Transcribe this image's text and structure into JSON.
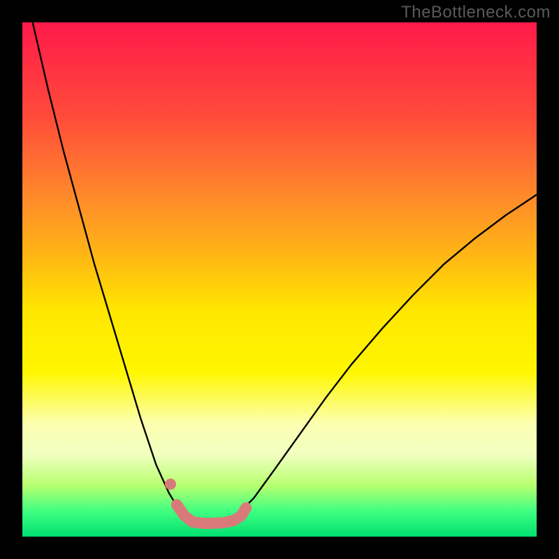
{
  "watermark": "TheBottleneck.com",
  "chart_data": {
    "type": "line",
    "title": "",
    "xlabel": "",
    "ylabel": "",
    "xlim": [
      0,
      100
    ],
    "ylim": [
      0,
      100
    ],
    "gradient_stops": [
      {
        "pos": 0,
        "color": "#ff1a4a"
      },
      {
        "pos": 18,
        "color": "#ff4a3a"
      },
      {
        "pos": 34,
        "color": "#ff8a2a"
      },
      {
        "pos": 45,
        "color": "#ffb515"
      },
      {
        "pos": 56,
        "color": "#ffe600"
      },
      {
        "pos": 68,
        "color": "#fff700"
      },
      {
        "pos": 78,
        "color": "#fcffb0"
      },
      {
        "pos": 84,
        "color": "#f0ffc0"
      },
      {
        "pos": 90,
        "color": "#b8ff70"
      },
      {
        "pos": 95,
        "color": "#40ff80"
      },
      {
        "pos": 100,
        "color": "#00e070"
      }
    ],
    "series": [
      {
        "name": "left-curve",
        "x": [
          2,
          5,
          8,
          11,
          14,
          17,
          20,
          23,
          26,
          28.5,
          30,
          31.5,
          33,
          34
        ],
        "y": [
          100,
          87,
          75,
          64,
          53,
          43,
          33,
          23,
          14,
          8.5,
          6,
          4.2,
          3.2,
          3.0
        ]
      },
      {
        "name": "right-curve",
        "x": [
          40,
          42,
          45,
          49,
          54,
          59,
          64,
          70,
          76,
          82,
          88,
          94,
          100
        ],
        "y": [
          3.2,
          4.5,
          7.5,
          13,
          20,
          27,
          33.5,
          40.5,
          47,
          53,
          58,
          62.5,
          66.5
        ]
      },
      {
        "name": "trough-marker",
        "x": [
          30,
          31.5,
          33,
          35,
          37,
          39,
          41,
          42.5,
          43.5
        ],
        "y": [
          6.2,
          4.1,
          2.9,
          2.6,
          2.6,
          2.7,
          3.1,
          4.0,
          5.6
        ]
      },
      {
        "name": "left-dot",
        "x": [
          28.8
        ],
        "y": [
          10.2
        ]
      }
    ],
    "colors": {
      "curve": "#000000",
      "marker": "#d97a7a"
    }
  }
}
